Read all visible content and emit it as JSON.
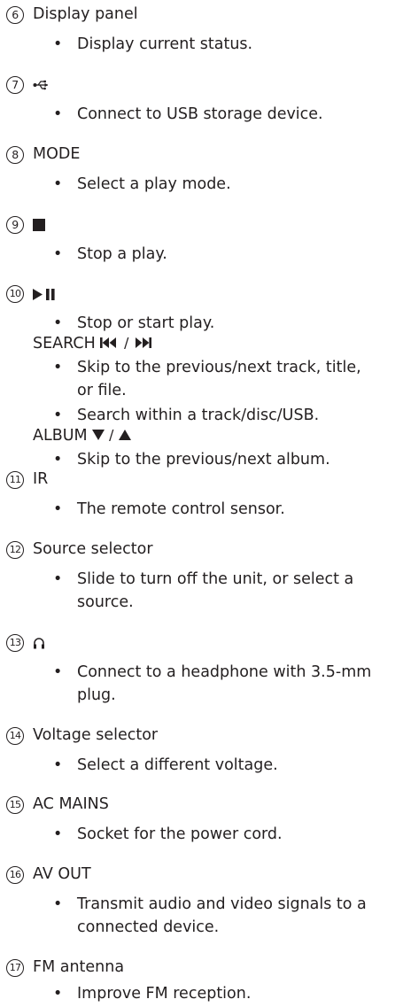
{
  "items": [
    {
      "num": "6",
      "title": "Display panel",
      "bullets": [
        "Display current status."
      ]
    },
    {
      "num": "7",
      "icon": "usb-icon",
      "bullets": [
        "Connect to USB storage device."
      ]
    },
    {
      "num": "8",
      "title": "MODE",
      "bullets": [
        "Select a play mode."
      ]
    },
    {
      "num": "9",
      "icon": "stop-icon",
      "bullets": [
        "Stop a play."
      ]
    },
    {
      "num": "10",
      "icon": "play-pause-icon",
      "bullets": [
        "Stop or start play."
      ],
      "sub1": {
        "label": "SEARCH",
        "icon": "prev-next-icon",
        "bullets": [
          "Skip to the previous/next track, title,",
          "or file.",
          "Search within a track/disc/USB."
        ]
      },
      "sub2": {
        "label": "ALBUM",
        "icon": "down-up-icon",
        "bullets": [
          "Skip to the previous/next album."
        ]
      }
    },
    {
      "num": "11",
      "title": "IR",
      "bullets": [
        "The remote control sensor."
      ]
    },
    {
      "num": "12",
      "title": "Source selector",
      "bullets": [
        "Slide to turn off the unit, or select a",
        "source."
      ]
    },
    {
      "num": "13",
      "icon": "headphone-icon",
      "bullets": [
        "Connect to a headphone with 3.5-mm",
        "plug."
      ]
    },
    {
      "num": "14",
      "title": "Voltage selector",
      "bullets": [
        "Select a different voltage."
      ]
    },
    {
      "num": "15",
      "title": "AC MAINS",
      "bullets": [
        "Socket for the power cord."
      ]
    },
    {
      "num": "16",
      "title": "AV OUT",
      "bullets": [
        "Transmit audio and video signals to a",
        "connected device."
      ]
    },
    {
      "num": "17",
      "title": "FM antenna",
      "bullets": [
        "Improve FM reception."
      ]
    }
  ]
}
